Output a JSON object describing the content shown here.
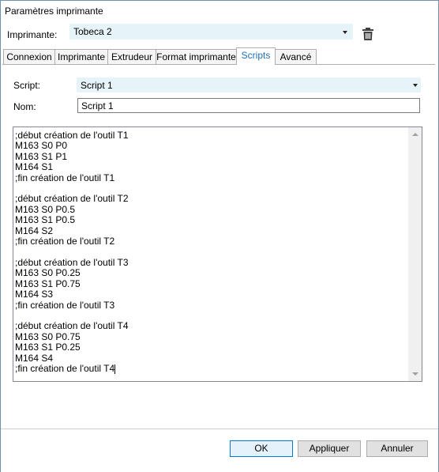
{
  "window": {
    "title": "Paramètres imprimante"
  },
  "printer": {
    "label": "Imprimante:",
    "value": "Tobeca 2"
  },
  "icons": {
    "delete": "trash-icon",
    "dropdown": "caret-down-icon"
  },
  "tabs": [
    {
      "label": "Connexion"
    },
    {
      "label": "Imprimante"
    },
    {
      "label": "Extrudeur"
    },
    {
      "label": "Format imprimante"
    },
    {
      "label": "Scripts",
      "active": true
    },
    {
      "label": "Avancé"
    }
  ],
  "script": {
    "label": "Script:",
    "value": "Script 1"
  },
  "name": {
    "label": "Nom:",
    "value": "Script 1"
  },
  "editor": {
    "lines": [
      ";début création de l'outil T1",
      "M163 S0 P0",
      "M163 S1 P1",
      "M164 S1",
      ";fin création de l'outil T1",
      "",
      ";début création de l'outil T2",
      "M163 S0 P0.5",
      "M163 S1 P0.5",
      "M164 S2",
      ";fin création de l'outil T2",
      "",
      ";début création de l'outil T3",
      "M163 S0 P0.25",
      "M163 S1 P0.75",
      "M164 S3",
      ";fin création de l'outil T3",
      "",
      ";début création de l'outil T4",
      "M163 S0 P0.75",
      "M163 S1 P0.25",
      "M164 S4",
      ";fin création de l'outil T4"
    ]
  },
  "buttons": {
    "ok": "OK",
    "apply": "Appliquer",
    "cancel": "Annuler"
  },
  "colors": {
    "accent": "#1e70b8",
    "select_bg": "#e6f3f8",
    "primary_border": "#0078d7"
  }
}
